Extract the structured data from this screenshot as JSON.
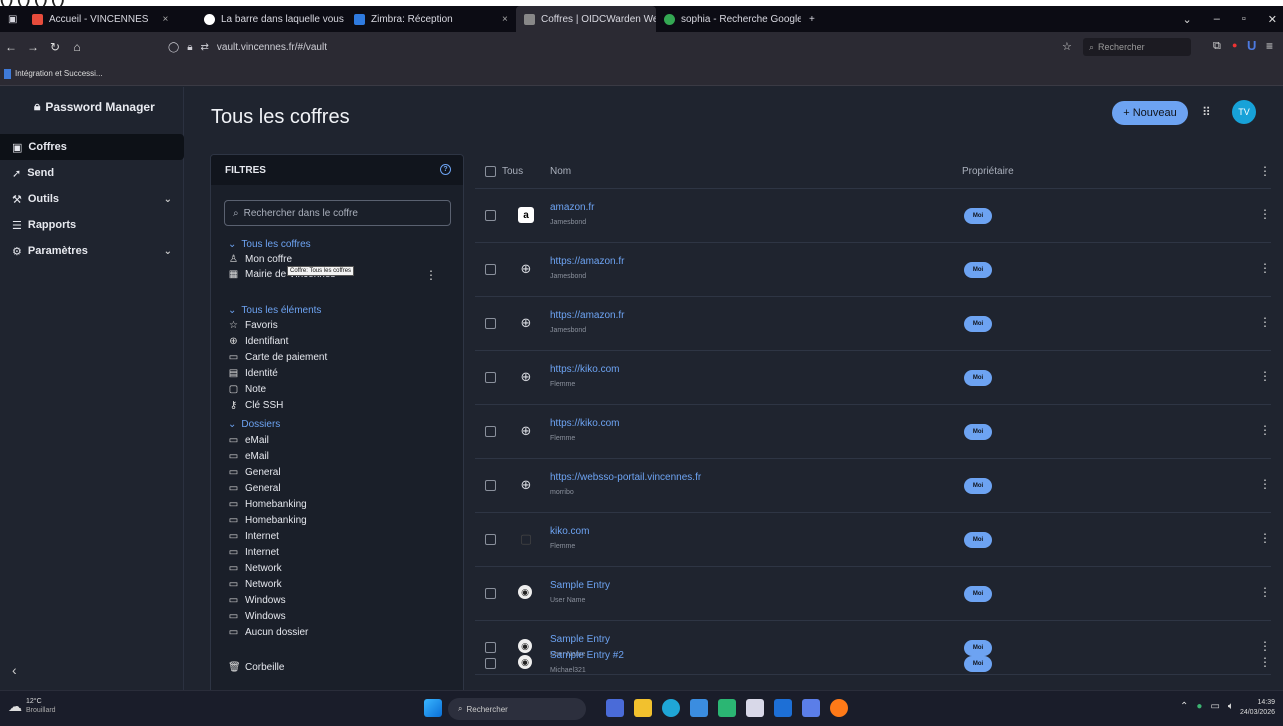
{
  "top_cut_text": "( ) ( ) ( ) ( )",
  "browser": {
    "tabs": [
      {
        "label": "Accueil - VINCENNES",
        "color": "#e74c3c"
      },
      {
        "label": "La barre dans laquelle vous vo...",
        "color": "#ffffff"
      },
      {
        "label": "Zimbra: Réception",
        "color": "#2f7be0"
      },
      {
        "label": "Coffres | OIDCWarden Web",
        "color": "#888888"
      },
      {
        "label": "sophia - Recherche Google",
        "color": "#34a853"
      }
    ],
    "new_tab": "+",
    "url": "vault.vincennes.fr/#/vault",
    "search_placeholder": "Rechercher",
    "bookmark": "Intégration et Successi..."
  },
  "sidebar": {
    "brand": "Password Manager",
    "items": [
      {
        "label": "Coffres",
        "icon": "vault-icon",
        "active": true
      },
      {
        "label": "Send",
        "icon": "send-icon"
      },
      {
        "label": "Outils",
        "icon": "tools-icon",
        "chevron": true
      },
      {
        "label": "Rapports",
        "icon": "reports-icon"
      },
      {
        "label": "Paramètres",
        "icon": "settings-icon",
        "chevron": true
      }
    ]
  },
  "header": {
    "title": "Tous les coffres",
    "new_button": "Nouveau",
    "avatar": "TV"
  },
  "filters": {
    "title": "FILTRES",
    "search_placeholder": "Rechercher dans le coffre",
    "all_vaults": "Tous les coffres",
    "vaults": [
      "Mon coffre",
      "Mairie de Vincennes"
    ],
    "tooltip": "Coffre: Tous les coffres",
    "all_items": "Tous les éléments",
    "types": [
      {
        "label": "Favoris",
        "icon": "star-icon"
      },
      {
        "label": "Identifiant",
        "icon": "globe-icon"
      },
      {
        "label": "Carte de paiement",
        "icon": "card-icon"
      },
      {
        "label": "Identité",
        "icon": "id-card-icon"
      },
      {
        "label": "Note",
        "icon": "note-icon"
      },
      {
        "label": "Clé SSH",
        "icon": "key-icon"
      }
    ],
    "folders_title": "Dossiers",
    "folders": [
      "eMail",
      "eMail",
      "General",
      "General",
      "Homebanking",
      "Homebanking",
      "Internet",
      "Internet",
      "Network",
      "Network",
      "Windows",
      "Windows",
      "Aucun dossier"
    ],
    "trash": "Corbeille"
  },
  "table": {
    "col_all": "Tous",
    "col_name": "Nom",
    "col_owner": "Propriétaire",
    "rows": [
      {
        "name": "amazon.fr",
        "user": "Jamesbond",
        "owner": "Moi",
        "icon": "amazon-icon"
      },
      {
        "name": "https://amazon.fr",
        "user": "Jamesbond",
        "owner": "Moi",
        "icon": "globe-icon"
      },
      {
        "name": "https://amazon.fr",
        "user": "Jamesbond",
        "owner": "Moi",
        "icon": "globe-icon"
      },
      {
        "name": "https://kiko.com",
        "user": "Flemme",
        "owner": "Moi",
        "icon": "globe-icon"
      },
      {
        "name": "https://kiko.com",
        "user": "Flemme",
        "owner": "Moi",
        "icon": "globe-icon"
      },
      {
        "name": "https://websso-portail.vincennes.fr",
        "user": "morribo",
        "owner": "Moi",
        "icon": "globe-icon"
      },
      {
        "name": "kiko.com",
        "user": "Flemme",
        "owner": "Moi",
        "icon": "site-favicon-icon"
      },
      {
        "name": "Sample Entry",
        "user": "User Name",
        "owner": "Moi",
        "icon": "keepass-icon"
      },
      {
        "name": "Sample Entry",
        "user": "User Name",
        "owner": "Moi",
        "icon": "keepass-icon"
      },
      {
        "name": "Sample Entry #2",
        "user": "Michael321",
        "owner": "Moi",
        "icon": "keepass-icon"
      }
    ]
  },
  "taskbar": {
    "temp": "12°C",
    "weather": "Brouillard",
    "search": "Rechercher",
    "time": "14:39",
    "date": "24/03/2026"
  }
}
